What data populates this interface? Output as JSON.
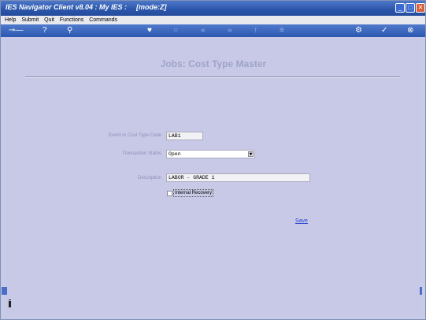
{
  "window": {
    "title": "IES Navigator Client v8.04 : My IES :",
    "mode": "[mode:Z]"
  },
  "menu": [
    "Help",
    "Submit",
    "Quit",
    "Functions",
    "Commands"
  ],
  "toolbar": {
    "icons": [
      "key-icon",
      "help-icon",
      "search-icon",
      "favorite-icon",
      "refresh-icon",
      "back-icon",
      "forward-icon",
      "up-icon",
      "menu-icon",
      "settings-icon",
      "check-icon",
      "close-icon"
    ],
    "glyphs": {
      "key": "⊸—",
      "help": "?",
      "search": "⚲",
      "favorite": "♥",
      "refresh": "○",
      "back": "«",
      "forward": "»",
      "up": "↑",
      "menu": "≡",
      "settings": "⚙",
      "check": "✓",
      "close": "⊗"
    }
  },
  "page": {
    "title": "Jobs: Cost Type Master"
  },
  "form": {
    "code_label": "Event or Cost Type Code",
    "code_value": "LAB1",
    "status_label": "Transaction Status",
    "status_value": "Open",
    "description_label": "Description",
    "description_value": "LABOR - GRADE 1",
    "internal_label": "Internal Recovery",
    "internal_checked": false
  },
  "actions": {
    "save_label": "Save"
  },
  "colors": {
    "background": "#c7c9e6",
    "titlebar": "#2a55aa",
    "link": "#2b44ce"
  }
}
